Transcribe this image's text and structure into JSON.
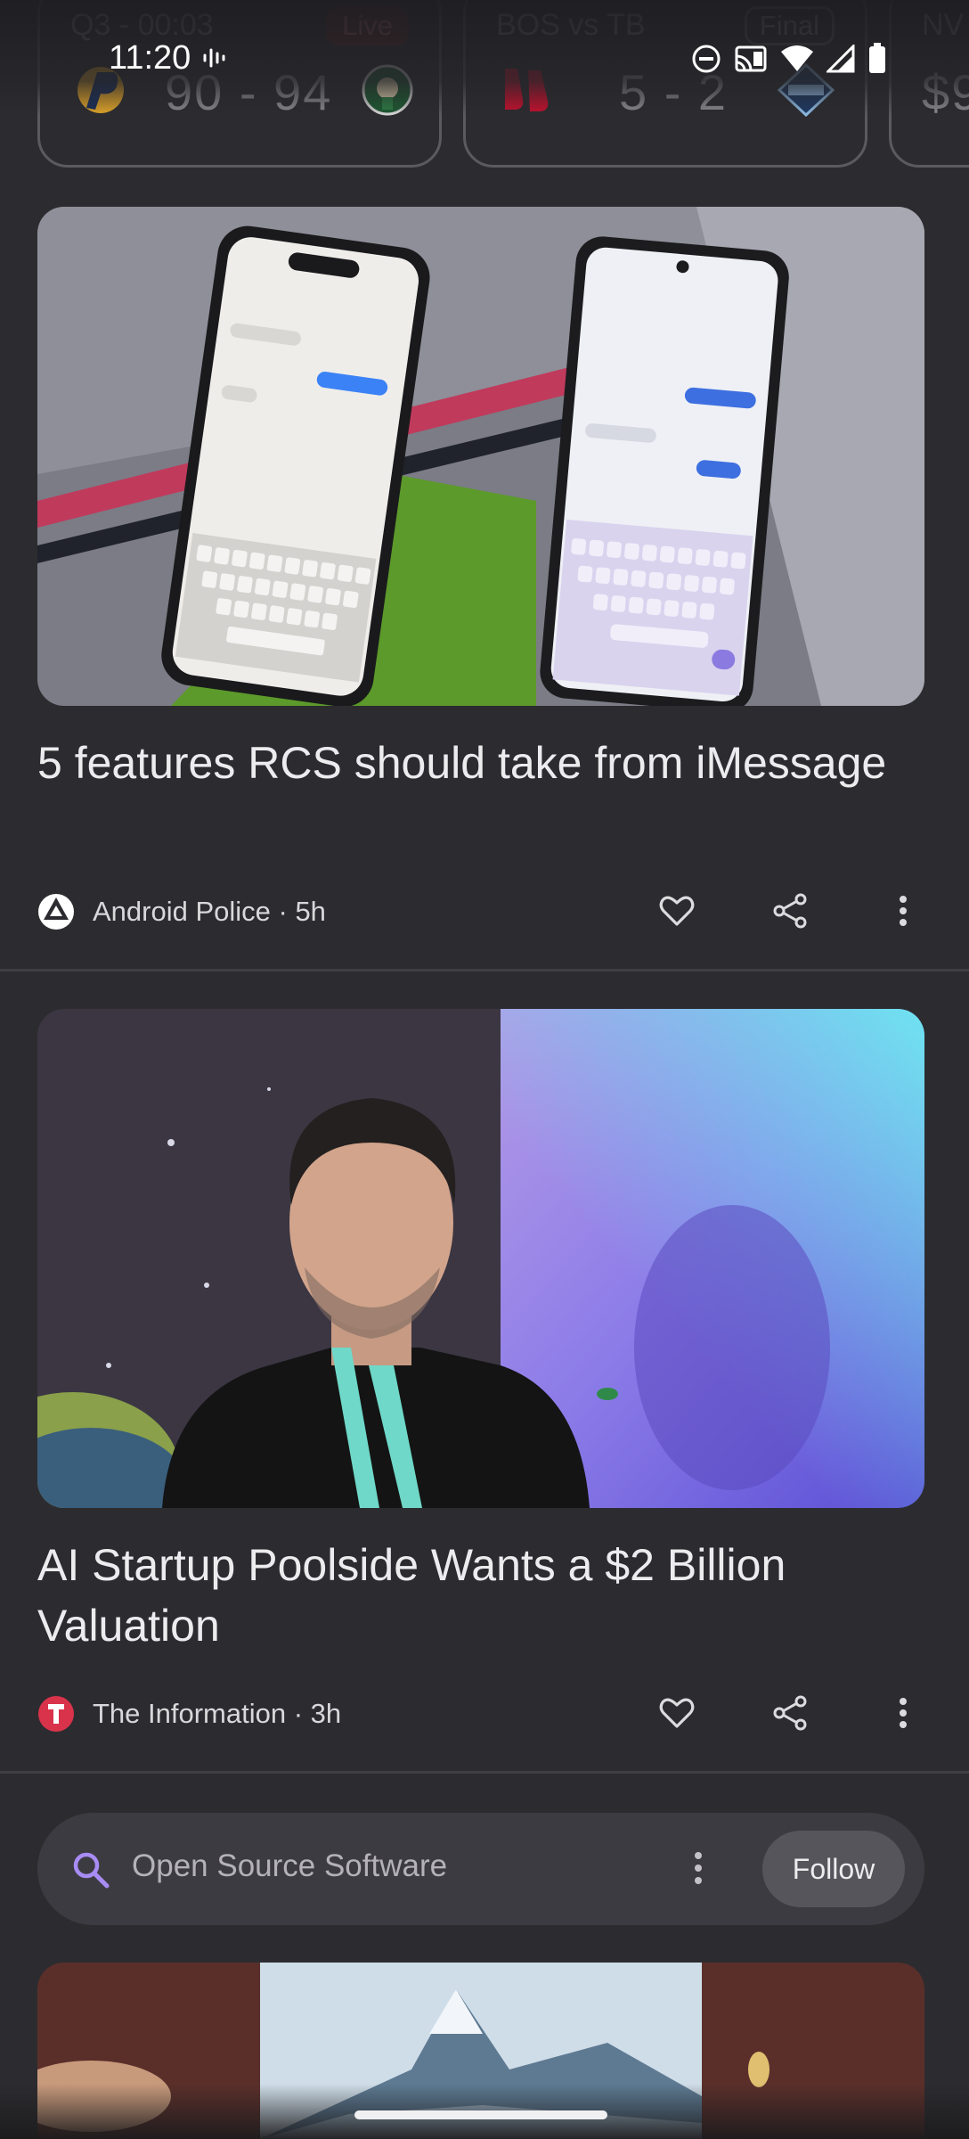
{
  "scores": [
    {
      "status": "Q3 - 00:03",
      "badge": "Live",
      "score": "90 - 94"
    },
    {
      "status": "BOS vs TB",
      "badge": "Final",
      "score": "5 - 2"
    },
    {
      "status": "NV",
      "score": "$9"
    }
  ],
  "statusbar": {
    "time": "11:20"
  },
  "articles": [
    {
      "title": "5 features RCS should take from iMessage",
      "source": "Android Police · 5h"
    },
    {
      "title": "AI Startup Poolside Wants a $2 Billion Valuation",
      "source": "The Information · 3h"
    }
  ],
  "topic": {
    "label": "Open Source Software",
    "follow_label": "Follow"
  },
  "colors": {
    "background": "#2c2c30",
    "live_badge": "#5b1f1f",
    "accent_search": "#a88cf5"
  }
}
